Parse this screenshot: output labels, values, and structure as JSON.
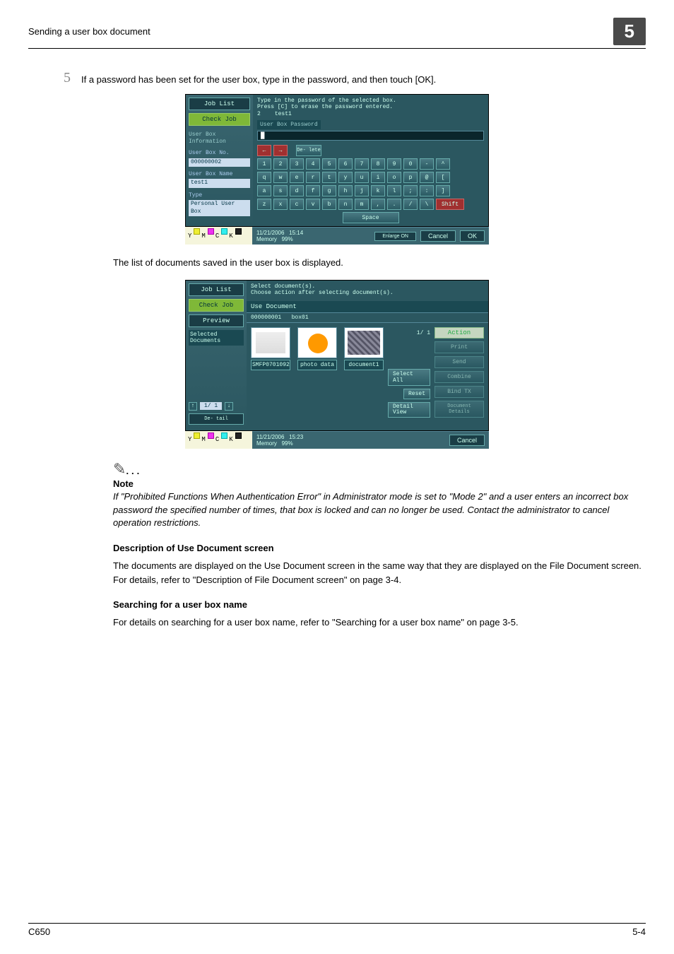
{
  "header": {
    "title": "Sending a user box document",
    "chapter": "5"
  },
  "step": {
    "num": "5",
    "text": "If a password has been set for the user box, type in the password, and then touch [OK]."
  },
  "screenshot1": {
    "prompt_line1": "Type in the password of the selected box.",
    "prompt_line2": "Press [C] to erase the password entered.",
    "box_ix": "2",
    "box_name_top": "test1",
    "left": {
      "job_list": "Job List",
      "check_job": "Check Job",
      "info_heading": "User Box Information",
      "box_no_label": "User Box No.",
      "box_no": "000000002",
      "box_name_label": "User Box Name",
      "box_name": "test1",
      "type_label": "Type",
      "type": "Personal User Box"
    },
    "field_label": "User Box Password",
    "kb": {
      "delete": "De- lete",
      "row1": [
        "1",
        "2",
        "3",
        "4",
        "5",
        "6",
        "7",
        "8",
        "9",
        "0",
        "-",
        "^"
      ],
      "row2": [
        "q",
        "w",
        "e",
        "r",
        "t",
        "y",
        "u",
        "i",
        "o",
        "p",
        "@",
        "["
      ],
      "row3": [
        "a",
        "s",
        "d",
        "f",
        "g",
        "h",
        "j",
        "k",
        "l",
        ";",
        ":",
        "]"
      ],
      "row4": [
        "z",
        "x",
        "c",
        "v",
        "b",
        "n",
        "m",
        ",",
        ".",
        "/",
        "\\"
      ],
      "shift": "Shift",
      "space": "Space"
    },
    "footer": {
      "date": "11/21/2006",
      "time": "15:14",
      "mem_label": "Memory",
      "mem": "99%",
      "enlarge": "Enlarge ON",
      "cancel": "Cancel",
      "ok": "OK"
    }
  },
  "mid_text": "The list of documents saved in the user box is displayed.",
  "screenshot2": {
    "prompt_line1": "Select document(s).",
    "prompt_line2": "Choose action after selecting document(s).",
    "left": {
      "job_list": "Job List",
      "check_job": "Check Job",
      "preview": "Preview",
      "sel_docs": "Selected Documents",
      "page": "1/  1",
      "detail": "De- tail"
    },
    "tab": "Use Document",
    "sub": {
      "id": "000000001",
      "name": "box01"
    },
    "thumbs": {
      "t1": "SMFP0701092",
      "t2": "photo data",
      "t3": "document1"
    },
    "mid": {
      "page": "1/  1",
      "select": "Select All",
      "reset": "Reset",
      "detail": "Detail View"
    },
    "right": {
      "action": "Action",
      "print": "Print",
      "send": "Send",
      "combine": "Combine",
      "bind": "Bind TX",
      "docdet": "Document Details"
    },
    "footer": {
      "date": "11/21/2006",
      "time": "15:23",
      "mem_label": "Memory",
      "mem": "99%",
      "cancel": "Cancel"
    }
  },
  "ymck": {
    "y": "Y",
    "m": "M",
    "c": "C",
    "k": "K"
  },
  "note": {
    "heading": "Note",
    "text": "If \"Prohibited Functions When Authentication Error\" in Administrator mode is set to \"Mode 2\" and a user enters an incorrect box password the specified number of times, that box is locked and can no longer be used. Contact the administrator to cancel operation restrictions."
  },
  "sections": {
    "desc_heading": "Description of Use Document screen",
    "desc_text": "The documents are displayed on the Use Document screen in the same way that they are displayed on the File Document screen. For details, refer to \"Description of File Document screen\" on page 3-4.",
    "search_heading": "Searching for a user box name",
    "search_text": "For details on searching for a user box name, refer to \"Searching for a user box name\" on page 3-5."
  },
  "footer": {
    "model": "C650",
    "page": "5-4"
  }
}
